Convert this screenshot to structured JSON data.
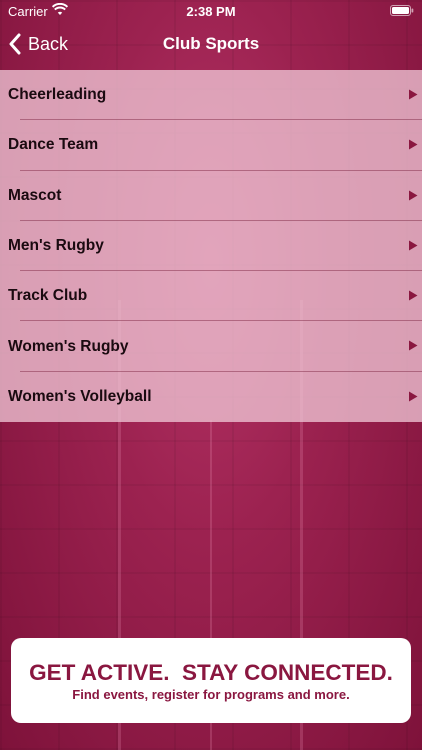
{
  "status_bar": {
    "carrier": "Carrier",
    "time": "2:38 PM"
  },
  "nav": {
    "back_label": "Back",
    "title": "Club Sports"
  },
  "list": {
    "items": [
      {
        "label": "Cheerleading"
      },
      {
        "label": "Dance Team"
      },
      {
        "label": "Mascot"
      },
      {
        "label": "Men's Rugby"
      },
      {
        "label": "Track Club"
      },
      {
        "label": "Women's Rugby"
      },
      {
        "label": "Women's Volleyball"
      }
    ]
  },
  "banner": {
    "headline": "GET ACTIVE.  STAY CONNECTED.",
    "subline": "Find events, register for programs and more."
  },
  "colors": {
    "brand": "#8a1740",
    "list_bg": "#eec4d4",
    "arrow": "#8a1740"
  },
  "icons": [
    "wifi-icon",
    "battery-icon",
    "chevron-left-icon",
    "disclosure-triangle-icon"
  ]
}
